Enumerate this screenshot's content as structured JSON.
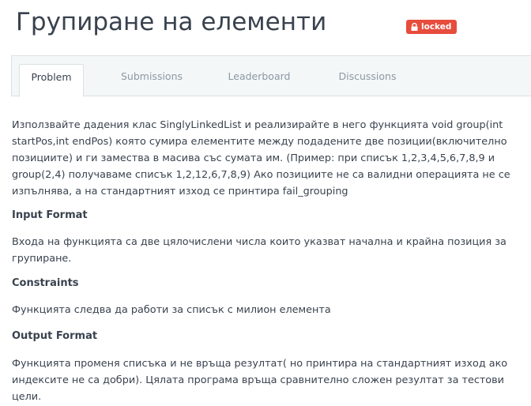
{
  "header": {
    "title": "Групиране на елементи",
    "badge_label": "locked",
    "badge_icon": "lock-icon",
    "badge_color": "#e74c3c"
  },
  "tabs": [
    {
      "label": "Problem",
      "active": true
    },
    {
      "label": "Submissions",
      "active": false
    },
    {
      "label": "Leaderboard",
      "active": false
    },
    {
      "label": "Discussions",
      "active": false
    }
  ],
  "problem": {
    "description": "Използвайте дадения клас SinglyLinkedList и реализирайте в него функцията void group(int startPos,int endPos) която сумира елементите между подадените две позиции(включително позициите) и ги замества в масива със сумата им. (Пример: при списък 1,2,3,4,5,6,7,8,9 и group(2,4) получаваме списък 1,2,12,6,7,8,9) Ако позициите не са валидни операцията не се изпълнява, а на стандартният изход се принтира fail_grouping",
    "input_format_heading": "Input Format",
    "input_format_text": "Входа на функцията са две цялочислени числа които указват начална и крайна позиция за групиране.",
    "constraints_heading": "Constraints",
    "constraints_text": "Функцията следва да работи за списък с милион елемента",
    "output_format_heading": "Output Format",
    "output_format_text": "Функцията променя списъка и не връща резултат( но принтира на стандартният изход ако индексите не са добри). Цялата програма връща сравнително сложен резултат за тестови цели."
  }
}
